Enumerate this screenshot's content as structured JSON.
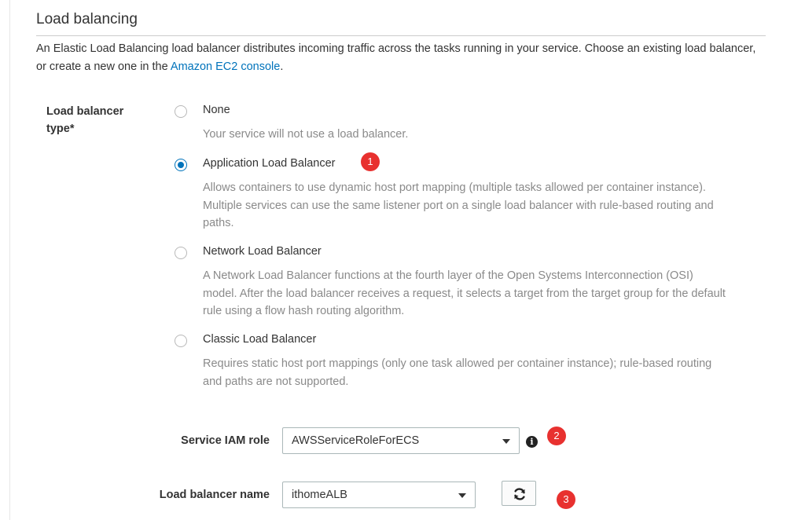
{
  "section": {
    "title": "Load balancing",
    "description_text": "An Elastic Load Balancing load balancer distributes incoming traffic across the tasks running in your service. Choose an existing load balancer, or create a new one in the ",
    "description_link": "Amazon EC2 console",
    "description_end": "."
  },
  "load_balancer_type": {
    "label": "Load balancer type*",
    "options": [
      {
        "label": "None",
        "description": "Your service will not use a load balancer.",
        "selected": false
      },
      {
        "label": "Application Load Balancer",
        "description": "Allows containers to use dynamic host port mapping (multiple tasks allowed per container instance). Multiple services can use the same listener port on a single load balancer with rule-based routing and paths.",
        "selected": true
      },
      {
        "label": "Network Load Balancer",
        "description": "A Network Load Balancer functions at the fourth layer of the Open Systems Interconnection (OSI) model. After the load balancer receives a request, it selects a target from the target group for the default rule using a flow hash routing algorithm.",
        "selected": false
      },
      {
        "label": "Classic Load Balancer",
        "description": "Requires static host port mappings (only one task allowed per container instance); rule-based routing and paths are not supported.",
        "selected": false
      }
    ]
  },
  "service_iam_role": {
    "label": "Service IAM role",
    "value": "AWSServiceRoleForECS",
    "info_icon": "info-icon"
  },
  "load_balancer_name": {
    "label": "Load balancer name",
    "value": "ithomeALB",
    "refresh_icon": "refresh-icon"
  },
  "annotations": [
    "1",
    "2",
    "3"
  ],
  "colors": {
    "link": "#0073bb",
    "radio_selected": "#0073bb",
    "badge": "#e8312f",
    "muted_text": "#8a8a8a"
  }
}
